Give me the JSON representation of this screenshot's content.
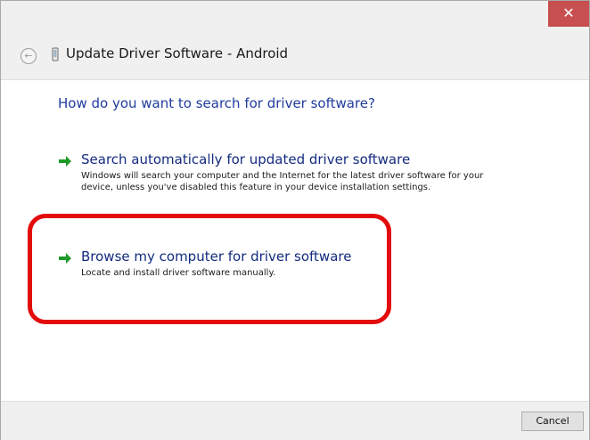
{
  "window": {
    "title": "Update Driver Software - Android",
    "close_glyph": "✕",
    "back_glyph": "←"
  },
  "main": {
    "question": "How do you want to search for driver software?",
    "options": [
      {
        "title": "Search automatically for updated driver software",
        "description": "Windows will search your computer and the Internet for the latest driver software for your device, unless you've disabled this feature in your device installation settings.",
        "icon": "green-arrow-icon"
      },
      {
        "title": "Browse my computer for driver software",
        "description": "Locate and install driver software manually.",
        "icon": "green-arrow-icon"
      }
    ]
  },
  "footer": {
    "cancel_label": "Cancel"
  },
  "colors": {
    "highlight": "#e30b0b",
    "link_blue": "#142b80",
    "question_blue": "#1f3b9d",
    "arrow_green": "#1f9a2a",
    "close_red": "#c74f50"
  }
}
